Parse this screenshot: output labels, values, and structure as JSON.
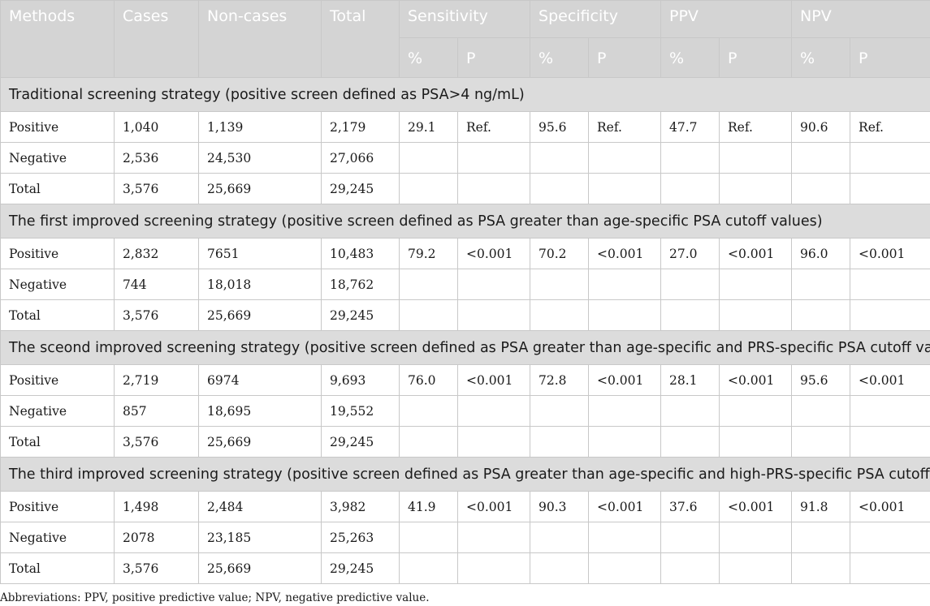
{
  "header": {
    "methods": "Methods",
    "cases": "Cases",
    "noncases": "Non-cases",
    "total": "Total",
    "metrics": [
      "Sensitivity",
      "Specificity",
      "PPV",
      "NPV"
    ],
    "sub_pct": "%",
    "sub_p": "P"
  },
  "sections": [
    {
      "title": "Traditional screening strategy (positive screen defined as PSA>4 ng/mL)",
      "rows": [
        {
          "label": "Positive",
          "cases": "1,040",
          "noncases": "1,139",
          "total": "2,179",
          "vals": [
            "29.1",
            "Ref.",
            "95.6",
            "Ref.",
            "47.7",
            "Ref.",
            "90.6",
            "Ref."
          ]
        },
        {
          "label": "Negative",
          "cases": "2,536",
          "noncases": "24,530",
          "total": "27,066",
          "vals": [
            "",
            "",
            "",
            "",
            "",
            "",
            "",
            ""
          ]
        },
        {
          "label": "Total",
          "cases": "3,576",
          "noncases": "25,669",
          "total": "29,245",
          "vals": [
            "",
            "",
            "",
            "",
            "",
            "",
            "",
            ""
          ]
        }
      ]
    },
    {
      "title": "The first improved screening strategy (positive screen defined as PSA greater than age-specific PSA cutoff values)",
      "rows": [
        {
          "label": "Positive",
          "cases": "2,832",
          "noncases": "7651",
          "total": "10,483",
          "vals": [
            "79.2",
            "<0.001",
            "70.2",
            "<0.001",
            "27.0",
            "<0.001",
            "96.0",
            "<0.001"
          ]
        },
        {
          "label": "Negative",
          "cases": "744",
          "noncases": "18,018",
          "total": "18,762",
          "vals": [
            "",
            "",
            "",
            "",
            "",
            "",
            "",
            ""
          ]
        },
        {
          "label": "Total",
          "cases": "3,576",
          "noncases": "25,669",
          "total": "29,245",
          "vals": [
            "",
            "",
            "",
            "",
            "",
            "",
            "",
            ""
          ]
        }
      ]
    },
    {
      "title": "The sceond improved screening strategy (positive screen defined as PSA greater than age-specific and PRS-specific PSA cutoff values)",
      "rows": [
        {
          "label": "Positive",
          "cases": "2,719",
          "noncases": "6974",
          "total": "9,693",
          "vals": [
            "76.0",
            "<0.001",
            "72.8",
            "<0.001",
            "28.1",
            "<0.001",
            "95.6",
            "<0.001"
          ]
        },
        {
          "label": "Negative",
          "cases": "857",
          "noncases": "18,695",
          "total": "19,552",
          "vals": [
            "",
            "",
            "",
            "",
            "",
            "",
            "",
            ""
          ]
        },
        {
          "label": "Total",
          "cases": "3,576",
          "noncases": "25,669",
          "total": "29,245",
          "vals": [
            "",
            "",
            "",
            "",
            "",
            "",
            "",
            ""
          ]
        }
      ]
    },
    {
      "title": "The third improved screening strategy (positive screen defined as PSA greater than age-specific and high-PRS-specific PSA cutoff values)",
      "rows": [
        {
          "label": "Positive",
          "cases": "1,498",
          "noncases": "2,484",
          "total": "3,982",
          "vals": [
            "41.9",
            "<0.001",
            "90.3",
            "<0.001",
            "37.6",
            "<0.001",
            "91.8",
            "<0.001"
          ]
        },
        {
          "label": "Negative",
          "cases": "2078",
          "noncases": "23,185",
          "total": "25,263",
          "vals": [
            "",
            "",
            "",
            "",
            "",
            "",
            "",
            ""
          ]
        },
        {
          "label": "Total",
          "cases": "3,576",
          "noncases": "25,669",
          "total": "29,245",
          "vals": [
            "",
            "",
            "",
            "",
            "",
            "",
            "",
            ""
          ]
        }
      ]
    }
  ],
  "footnote": "Abbreviations: PPV, positive predictive value; NPV, negative predictive value.",
  "colors": {
    "header_bg": "#d4d4d4",
    "header_text": "#ffffff",
    "section_bg": "#dcdcdc",
    "border": "#c8c8c8"
  }
}
